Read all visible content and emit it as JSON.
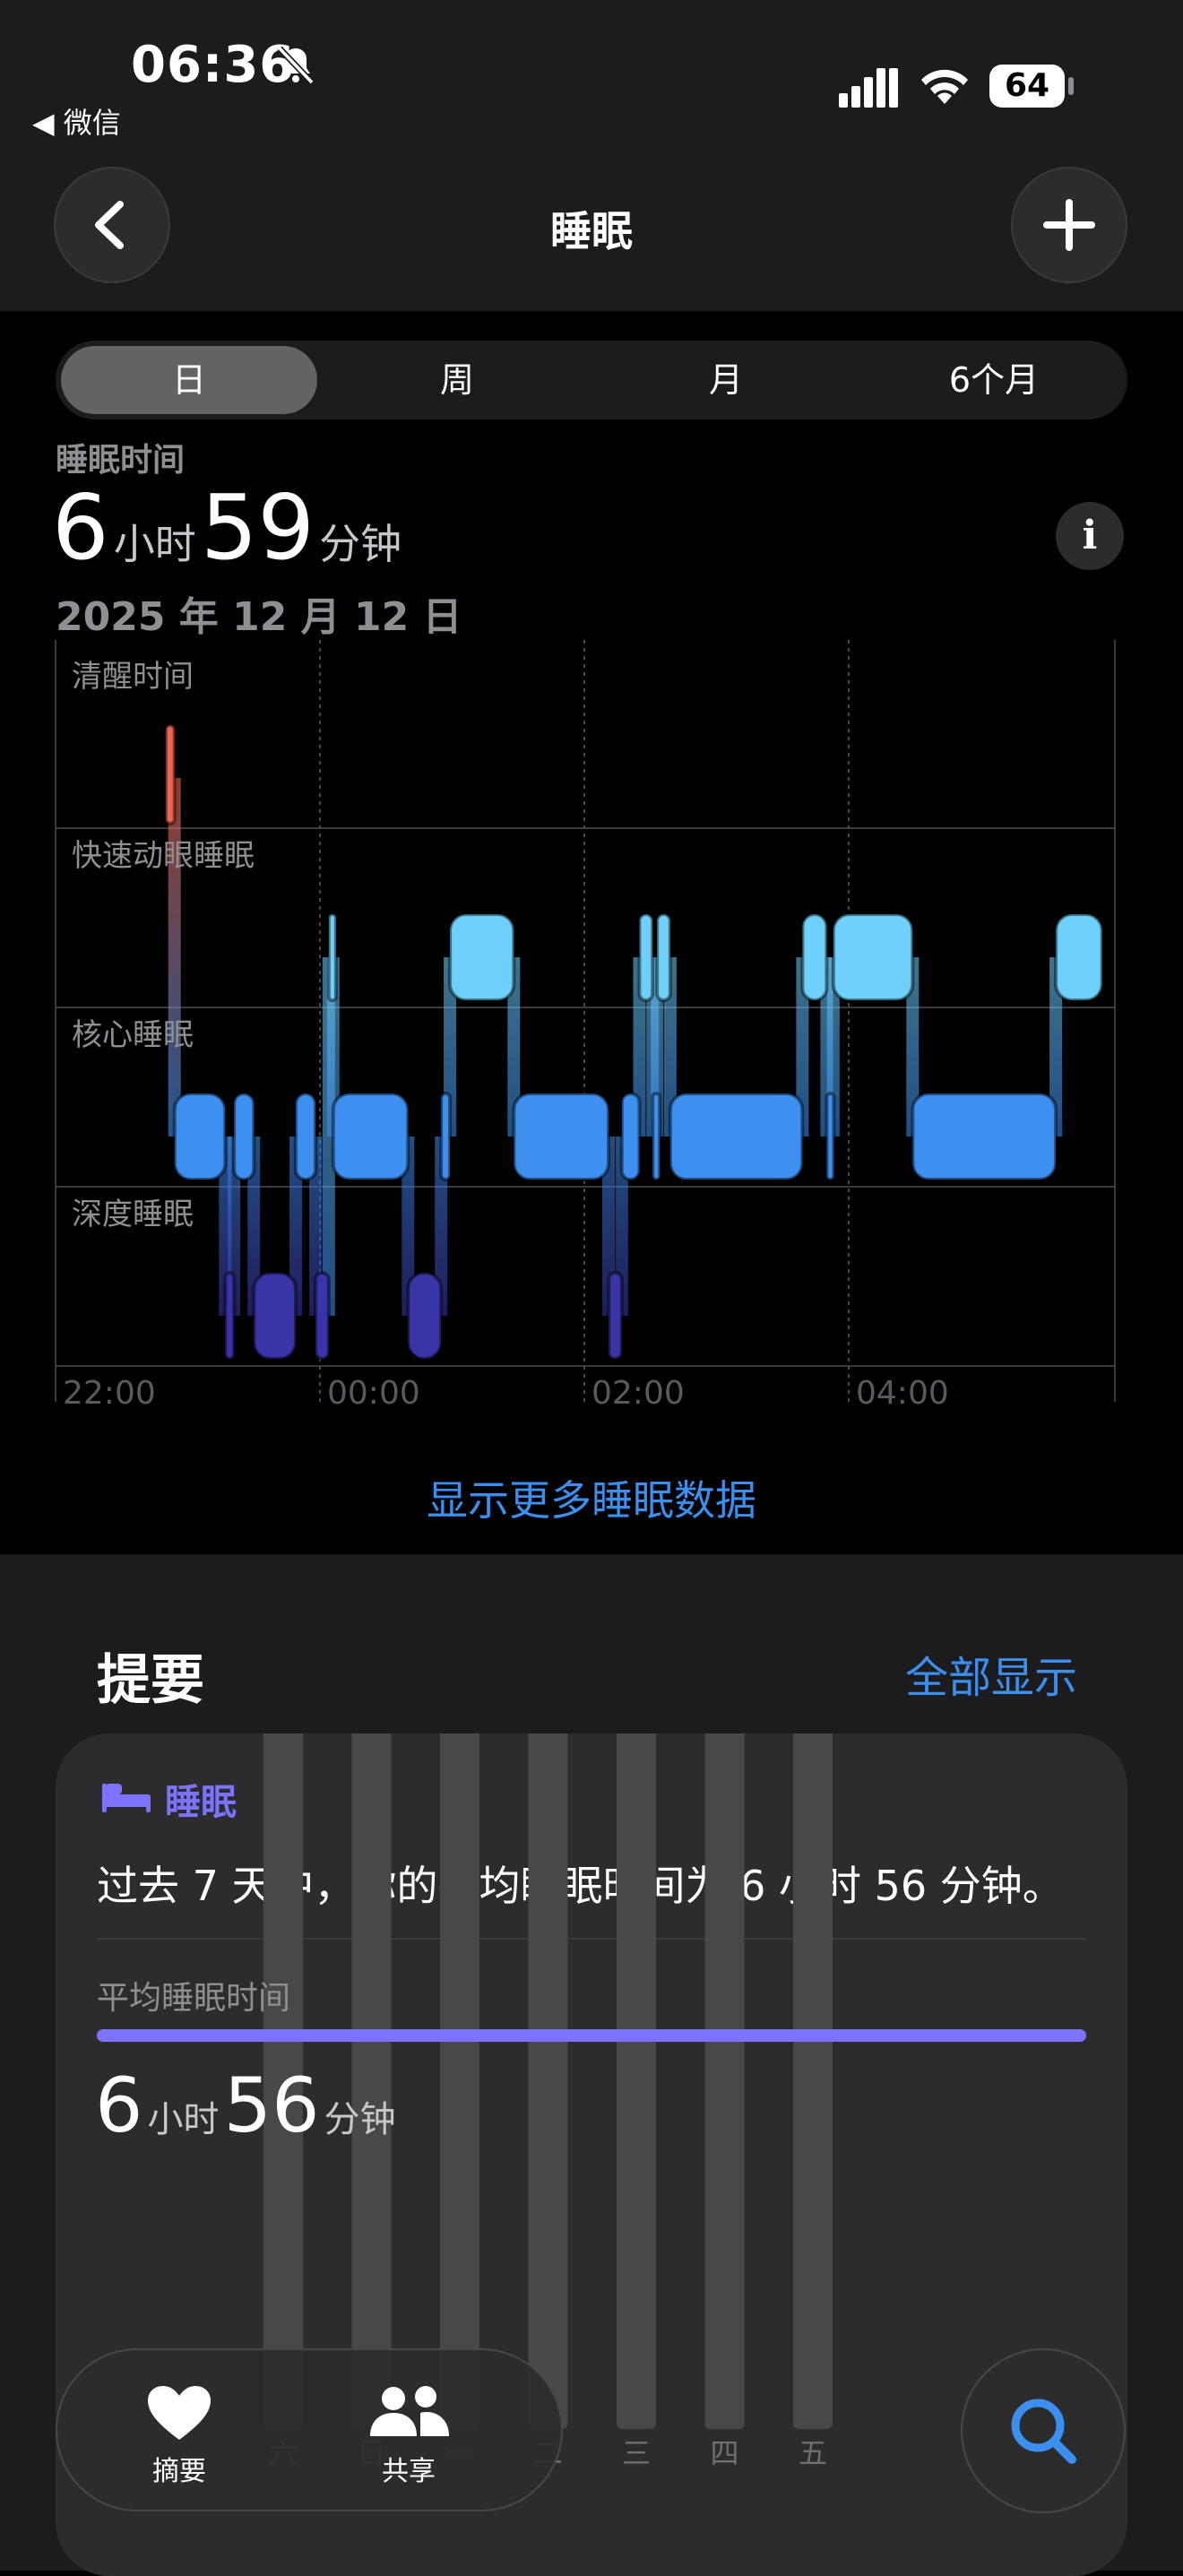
{
  "status_bar": {
    "time": "06:36",
    "battery": "64",
    "back_app": "◀ 微信"
  },
  "nav": {
    "title": "睡眠"
  },
  "segments": [
    "日",
    "周",
    "月",
    "6个月"
  ],
  "sleep": {
    "label": "睡眠时间",
    "hours": "6",
    "hours_unit": "小时",
    "minutes": "59",
    "minutes_unit": "分钟",
    "date": "2025 年 12 月 12 日",
    "info": "i"
  },
  "chart_data": {
    "type": "hypnogram",
    "stages": [
      "清醒时间",
      "快速动眼睡眠",
      "核心睡眠",
      "深度睡眠"
    ],
    "x_ticks": [
      "22:00",
      "00:00",
      "02:00",
      "04:00"
    ],
    "colors": {
      "awake": "#f0654f",
      "rem": "#6fd1fb",
      "core": "#3d8ff0",
      "deep": "#3a34a8"
    },
    "segments": [
      {
        "stage": 0,
        "start": "22:50",
        "end": "22:54"
      },
      {
        "stage": 2,
        "start": "22:54",
        "end": "23:17"
      },
      {
        "stage": 3,
        "start": "23:17",
        "end": "23:21"
      },
      {
        "stage": 2,
        "start": "23:21",
        "end": "23:30"
      },
      {
        "stage": 3,
        "start": "23:30",
        "end": "23:49"
      },
      {
        "stage": 2,
        "start": "23:49",
        "end": "23:58"
      },
      {
        "stage": 3,
        "start": "23:58",
        "end": "00:04"
      },
      {
        "stage": 1,
        "start": "00:04",
        "end": "00:06"
      },
      {
        "stage": 2,
        "start": "00:06",
        "end": "00:40"
      },
      {
        "stage": 3,
        "start": "00:40",
        "end": "00:55"
      },
      {
        "stage": 2,
        "start": "00:55",
        "end": "00:59"
      },
      {
        "stage": 1,
        "start": "00:59",
        "end": "01:28"
      },
      {
        "stage": 2,
        "start": "01:28",
        "end": "02:11"
      },
      {
        "stage": 3,
        "start": "02:11",
        "end": "02:17"
      },
      {
        "stage": 2,
        "start": "02:17",
        "end": "02:25"
      },
      {
        "stage": 1,
        "start": "02:25",
        "end": "02:31"
      },
      {
        "stage": 2,
        "start": "02:31",
        "end": "02:33"
      },
      {
        "stage": 1,
        "start": "02:33",
        "end": "02:39"
      },
      {
        "stage": 2,
        "start": "02:39",
        "end": "03:39"
      },
      {
        "stage": 1,
        "start": "03:39",
        "end": "03:50"
      },
      {
        "stage": 2,
        "start": "03:50",
        "end": "03:53"
      },
      {
        "stage": 1,
        "start": "03:53",
        "end": "04:29"
      },
      {
        "stage": 2,
        "start": "04:29",
        "end": "05:34"
      },
      {
        "stage": 1,
        "start": "05:34",
        "end": "05:55"
      }
    ]
  },
  "show_more": "显示更多睡眠数据",
  "summary": {
    "title": "提要",
    "show_all": "全部显示"
  },
  "card": {
    "category": "睡眠",
    "text": "过去 7 天中，你的平均睡眠时间为 6 小时 56 分钟。",
    "avg_label": "平均睡眠时间",
    "hours": "6",
    "hours_unit": "小时",
    "minutes": "56",
    "minutes_unit": "分钟",
    "week_days": [
      "六",
      "日",
      "一",
      "二",
      "三",
      "四",
      "五"
    ],
    "bar_hours": [
      6.2,
      6.9,
      6.8,
      6.8,
      7.0,
      6.8,
      6.8
    ]
  },
  "tabbar": {
    "summary": "摘要",
    "sharing": "共享"
  },
  "accent": "#3b8fee",
  "sleep_purple": "#7c74ff"
}
